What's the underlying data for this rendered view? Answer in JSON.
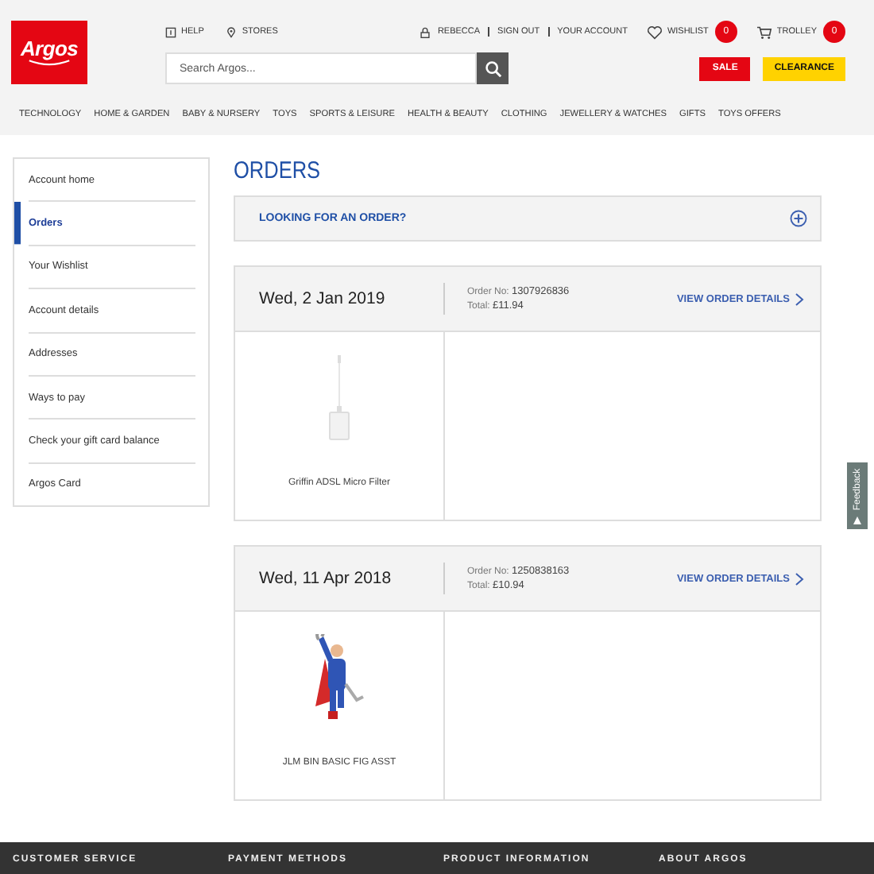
{
  "header": {
    "logo": "Argos",
    "help": "HELP",
    "stores": "STORES",
    "user": "REBECCA",
    "account_links": [
      "SIGN OUT",
      "YOUR ACCOUNT"
    ],
    "wishlist": {
      "label": "WISHLIST",
      "count": "0"
    },
    "trolley": {
      "label": "TROLLEY",
      "count": "0"
    },
    "search": {
      "placeholder": "Search Argos..."
    },
    "promo_buttons": [
      {
        "label": "SALE",
        "kind": "sale"
      },
      {
        "label": "CLEARANCE",
        "kind": "clearance"
      }
    ]
  },
  "nav": [
    "TECHNOLOGY",
    "HOME & GARDEN",
    "BABY & NURSERY",
    "TOYS",
    "SPORTS & LEISURE",
    "HEALTH & BEAUTY",
    "CLOTHING",
    "JEWELLERY & WATCHES",
    "GIFTS",
    "TOYS OFFERS"
  ],
  "sidebar": {
    "items": [
      {
        "label": "Account home",
        "selected": false
      },
      {
        "label": "Orders",
        "selected": true
      },
      {
        "label": "Your Wishlist",
        "selected": false
      },
      {
        "label": "Account details",
        "selected": false
      },
      {
        "label": "Addresses",
        "selected": false
      },
      {
        "label": "Ways to pay",
        "selected": false
      },
      {
        "label": "Check your gift card balance",
        "selected": false
      },
      {
        "label": "Argos Card",
        "selected": false
      }
    ]
  },
  "page_title": "ORDERS",
  "lookup": {
    "label": "LOOKING FOR AN ORDER?",
    "expanded": false
  },
  "orders": [
    {
      "date": "Wed, 2 Jan 2019",
      "order_no_label": "Order No:",
      "order_no": "1307926836",
      "total_label": "Total:",
      "total": "£11.94",
      "link": "VIEW ORDER DETAILS",
      "items": [
        {
          "name": "Griffin ADSL Micro Filter",
          "kind": "picture"
        }
      ]
    },
    {
      "date": "Wed, 11 Apr 2018",
      "order_no_label": "Order No:",
      "order_no": "1250838163",
      "total_label": "Total:",
      "total": "£10.94",
      "link": "VIEW ORDER DETAILS",
      "items": [
        {
          "name": "JLM BIN BASIC FIG ASST",
          "kind": "picture"
        }
      ]
    }
  ],
  "feedback": "Feedback",
  "footer": {
    "headings": [
      "CUSTOMER SERVICE",
      "PAYMENT METHODS",
      "PRODUCT INFORMATION",
      "ABOUT ARGOS"
    ]
  }
}
